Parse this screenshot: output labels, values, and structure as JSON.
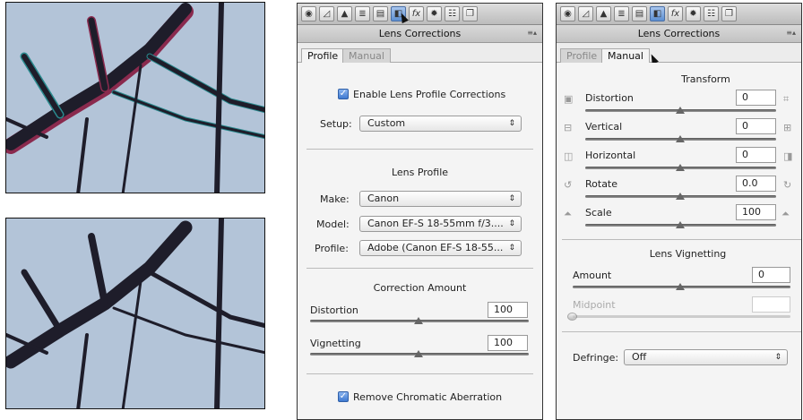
{
  "toolbar": {
    "icons": [
      "aperture-icon",
      "tone-curve-icon",
      "detail-icon",
      "hsl-icon",
      "split-tone-icon",
      "lens-icon",
      "fx-icon",
      "camera-calibration-icon",
      "presets-icon",
      "snapshots-icon"
    ],
    "fx_label": "fx"
  },
  "panel_title": "Lens Corrections",
  "tabs": {
    "profile": "Profile",
    "manual": "Manual"
  },
  "profile_panel": {
    "enable_label": "Enable Lens Profile Corrections",
    "setup_label": "Setup:",
    "setup_value": "Custom",
    "lens_profile_heading": "Lens Profile",
    "make_label": "Make:",
    "make_value": "Canon",
    "model_label": "Model:",
    "model_value": "Canon EF-S 18-55mm f/3....",
    "profile_label": "Profile:",
    "profile_value": "Adobe (Canon EF-S 18-55...",
    "correction_heading": "Correction Amount",
    "distortion_label": "Distortion",
    "distortion_value": "100",
    "vignetting_label": "Vignetting",
    "vignetting_value": "100",
    "chromatic_label": "Remove Chromatic Aberration"
  },
  "manual_panel": {
    "transform_heading": "Transform",
    "distortion_label": "Distortion",
    "distortion_value": "0",
    "vertical_label": "Vertical",
    "vertical_value": "0",
    "horizontal_label": "Horizontal",
    "horizontal_value": "0",
    "rotate_label": "Rotate",
    "rotate_value": "0.0",
    "scale_label": "Scale",
    "scale_value": "100",
    "vignetting_heading": "Lens Vignetting",
    "amount_label": "Amount",
    "amount_value": "0",
    "midpoint_label": "Midpoint",
    "defringe_label": "Defringe:",
    "defringe_value": "Off"
  },
  "colors": {
    "photo_sky": "#b3c4d8",
    "branch": "#1e1d2a",
    "fringe_magenta": "#8a2a4e",
    "fringe_cyan": "#2a8a8e",
    "checkbox": "#3f7ad0"
  }
}
